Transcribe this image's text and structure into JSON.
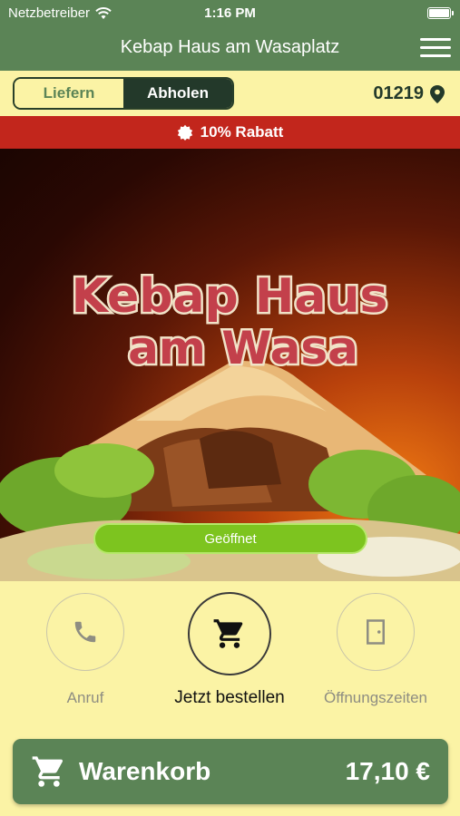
{
  "status_bar": {
    "carrier": "Netzbetreiber",
    "time": "1:16 PM"
  },
  "header": {
    "title": "Kebap Haus am Wasaplatz",
    "menu_icon": "hamburger-menu-icon"
  },
  "order_mode": {
    "options": [
      "Liefern",
      "Abholen"
    ],
    "selected": "Abholen",
    "postcode": "01219",
    "location_icon": "location-pin-icon"
  },
  "promo": {
    "icon": "badge-star-icon",
    "text": "10% Rabatt"
  },
  "hero": {
    "logo_line1": "Kebap Haus",
    "logo_line2": "am Wasa",
    "status": "Geöffnet"
  },
  "actions": {
    "call": {
      "label": "Anruf",
      "icon": "phone-icon"
    },
    "order": {
      "label": "Jetzt bestellen",
      "icon": "shopping-cart-icon"
    },
    "hours": {
      "label": "Öffnungszeiten",
      "icon": "door-icon"
    }
  },
  "cart": {
    "label": "Warenkorb",
    "total": "17,10 €",
    "icon": "shopping-cart-icon"
  },
  "colors": {
    "brand_green": "#5b8456",
    "dark_green": "#23392a",
    "background_yellow": "#fbf3a5",
    "promo_red": "#c2261c",
    "open_green": "#7dc41f"
  }
}
